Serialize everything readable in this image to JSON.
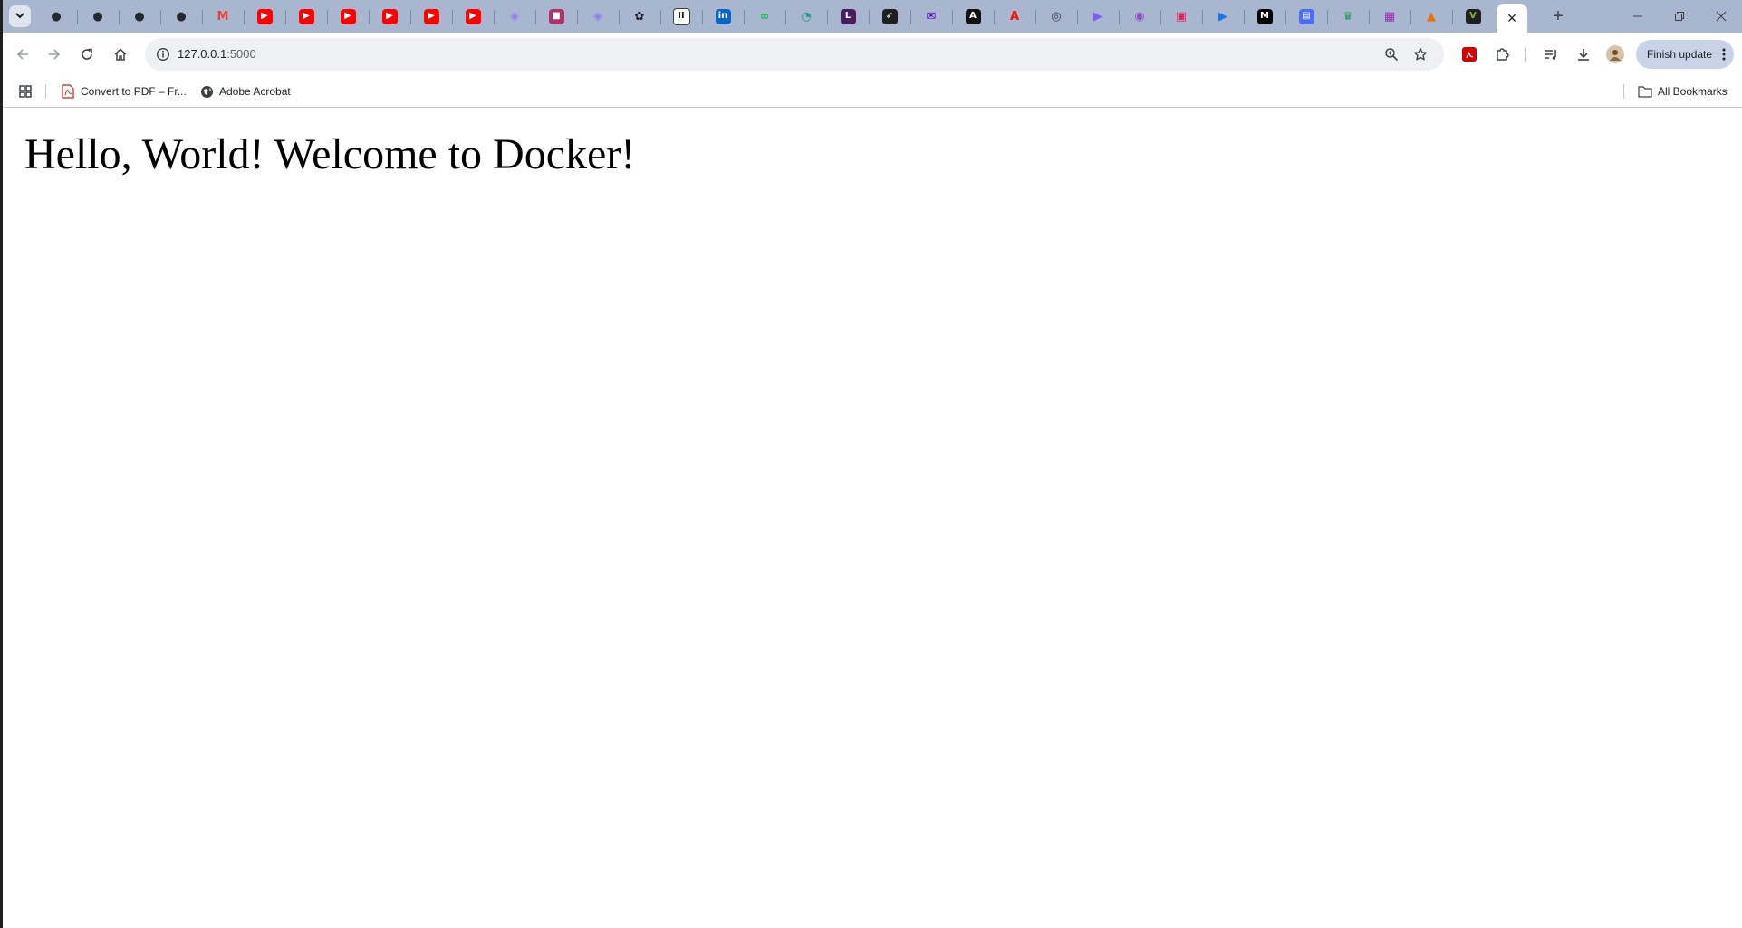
{
  "browser": {
    "tabs": {
      "pinned": [
        {
          "icon": "github-icon",
          "color": "#24292f"
        },
        {
          "icon": "github-icon",
          "color": "#24292f"
        },
        {
          "icon": "github-icon",
          "color": "#24292f"
        },
        {
          "icon": "github-icon",
          "color": "#24292f"
        },
        {
          "icon": "gmail-icon",
          "color": "#ea4335"
        },
        {
          "icon": "youtube-icon",
          "color": "#ff0000"
        },
        {
          "icon": "youtube-icon",
          "color": "#ff0000"
        },
        {
          "icon": "youtube-icon",
          "color": "#ff0000"
        },
        {
          "icon": "youtube-icon",
          "color": "#ff0000"
        },
        {
          "icon": "youtube-icon",
          "color": "#ff0000"
        },
        {
          "icon": "youtube-icon",
          "color": "#ff0000"
        },
        {
          "icon": "cube-icon",
          "color": "#8e7cf0"
        },
        {
          "icon": "gradient-square-icon",
          "color": "#b0306a"
        },
        {
          "icon": "cube-icon",
          "color": "#8e7cf0"
        },
        {
          "icon": "openai-icon",
          "color": "#202124"
        },
        {
          "icon": "pause-app-icon",
          "color": "#202124"
        },
        {
          "icon": "linkedin-icon",
          "color": "#0a66c2"
        },
        {
          "icon": "infinity-icon",
          "color": "#1db954"
        },
        {
          "icon": "chat-bubble-icon",
          "color": "#10a37f"
        },
        {
          "icon": "lmh-icon",
          "color": "#4b1d5e"
        },
        {
          "icon": "rocket-icon",
          "color": "#1f1f1f"
        },
        {
          "icon": "mail-icon",
          "color": "#6001d2"
        },
        {
          "icon": "triangle-a-icon",
          "color": "#111111"
        },
        {
          "icon": "adobe-icon",
          "color": "#fa0f00"
        },
        {
          "icon": "compass-icon",
          "color": "#3c4043"
        },
        {
          "icon": "video-icon",
          "color": "#7b5cf5"
        },
        {
          "icon": "podcast-icon",
          "color": "#8a4fc7"
        },
        {
          "icon": "image-icon",
          "color": "#e0245e"
        },
        {
          "icon": "play-arrow-icon",
          "color": "#1a73e8"
        },
        {
          "icon": "medium-icon",
          "color": "#000000"
        },
        {
          "icon": "printer-icon",
          "color": "#4c6ef5"
        },
        {
          "icon": "crown-icon",
          "color": "#2e9e5b"
        },
        {
          "icon": "qr-icon",
          "color": "#9c27b0"
        },
        {
          "icon": "chart-icon",
          "color": "#e8710a"
        },
        {
          "icon": "vimeo-v-icon",
          "color": "#7cbd2a"
        }
      ],
      "active_close_label": "×",
      "new_tab_label": "+"
    },
    "omnibox": {
      "host": "127.0.0.1",
      "port": ":5000"
    },
    "toolbar": {
      "finish_update_label": "Finish update"
    },
    "bookmarks": [
      {
        "label": "Convert to PDF – Fr...",
        "icon": "pdf-file-icon"
      },
      {
        "label": "Adobe Acrobat",
        "icon": "globe-icon"
      }
    ],
    "all_bookmarks_label": "All Bookmarks",
    "accent": "#a9b6d0"
  },
  "page": {
    "heading": "Hello, World! Welcome to Docker!"
  }
}
